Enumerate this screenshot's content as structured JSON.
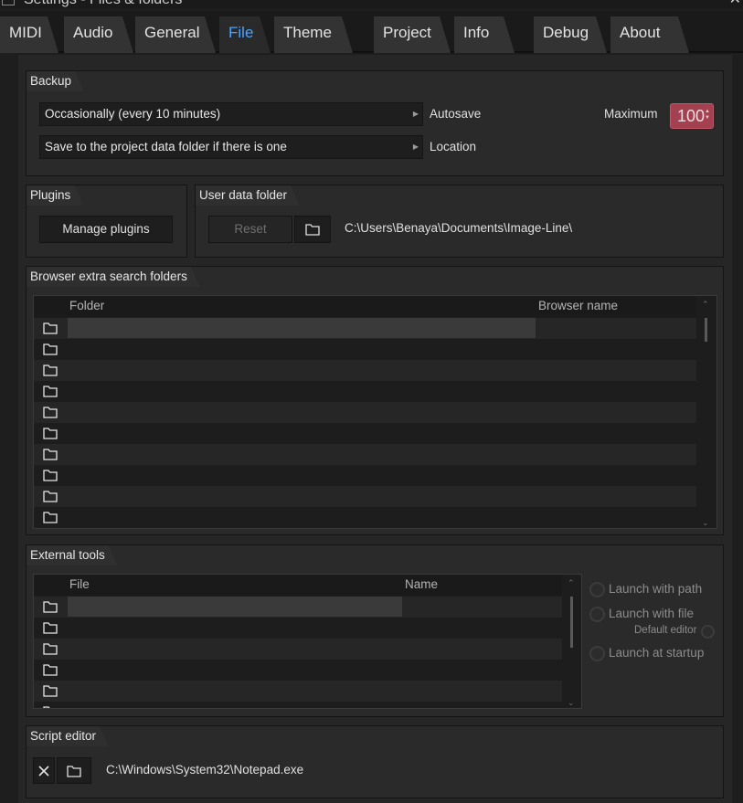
{
  "window": {
    "title": "Settings - Files & folders",
    "close_glyph": "✕"
  },
  "tabs": [
    {
      "label": "MIDI",
      "active": false
    },
    {
      "label": "Audio",
      "active": false
    },
    {
      "label": "General",
      "active": false
    },
    {
      "label": "File",
      "active": true
    },
    {
      "label": "Theme",
      "active": false
    },
    {
      "label": "Project",
      "active": false
    },
    {
      "label": "Info",
      "active": false
    },
    {
      "label": "Debug",
      "active": false
    },
    {
      "label": "About",
      "active": false
    }
  ],
  "backup": {
    "title": "Backup",
    "autosave_value": "Occasionally (every 10 minutes)",
    "autosave_label": "Autosave",
    "location_value": "Save to the project data folder if there is one",
    "location_label": "Location",
    "maximum_label": "Maximum",
    "maximum_value": "100"
  },
  "plugins": {
    "title": "Plugins",
    "manage_label": "Manage plugins"
  },
  "user_data": {
    "title": "User data folder",
    "reset_label": "Reset",
    "path": "C:\\Users\\Benaya\\Documents\\Image-Line\\"
  },
  "browser": {
    "title": "Browser extra search folders",
    "col_folder": "Folder",
    "col_name": "Browser name",
    "row_count": 10
  },
  "external": {
    "title": "External tools",
    "col_file": "File",
    "col_name": "Name",
    "row_count": 6,
    "launch_with_path": "Launch with path",
    "launch_with_file": "Launch with file",
    "default_editor": "Default editor",
    "launch_at_startup": "Launch at startup"
  },
  "script_editor": {
    "title": "Script editor",
    "path": "C:\\Windows\\System32\\Notepad.exe"
  },
  "colors": {
    "accent": "#4aa3ff",
    "spinner": "#a34150",
    "panel": "#2a2a2a",
    "background": "#1e1e1e"
  },
  "icons": [
    "folder-icon",
    "close-icon",
    "dropdown-arrow-icon"
  ]
}
